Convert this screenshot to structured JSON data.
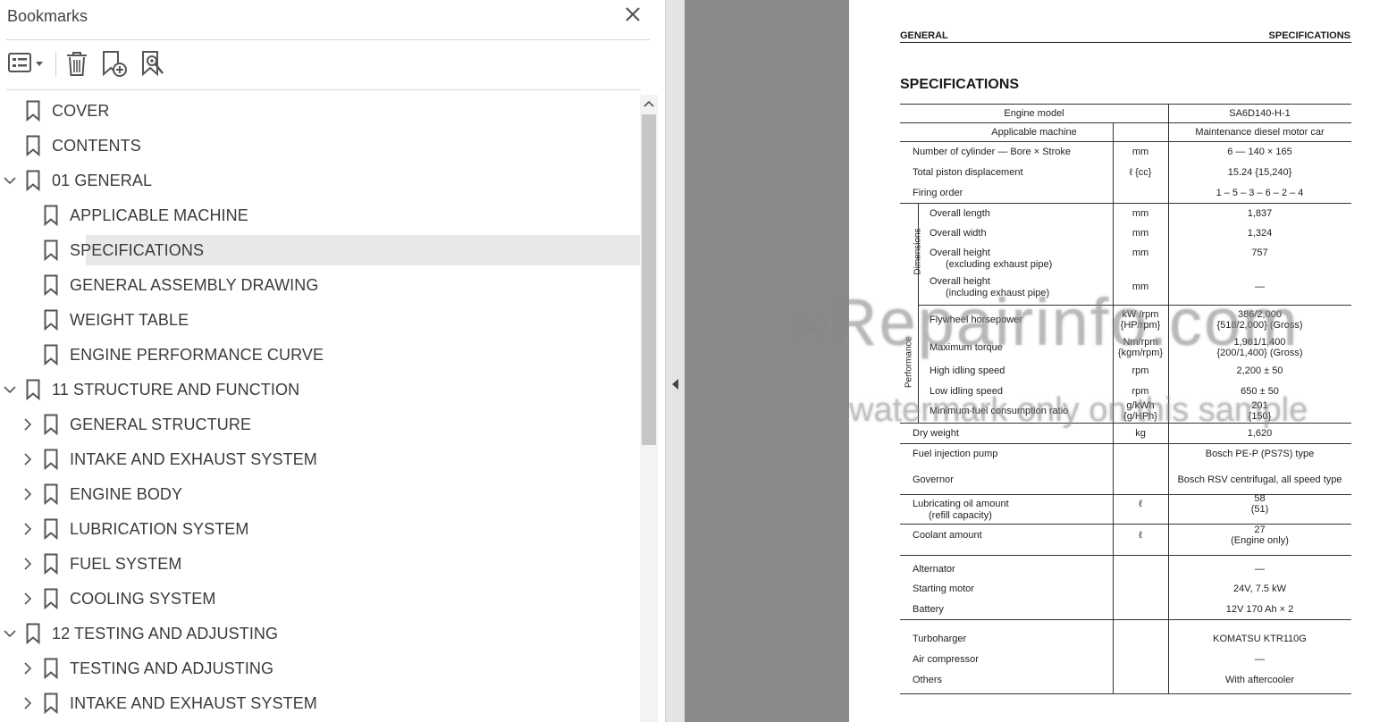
{
  "bookmarks_panel": {
    "title": "Bookmarks",
    "toolbar": {
      "options_icon": "list-options-icon",
      "delete_icon": "trash-icon",
      "add_icon": "bookmark-add-icon",
      "find_icon": "bookmark-search-icon"
    },
    "items": [
      {
        "label": "COVER",
        "level": 0,
        "expander": "none"
      },
      {
        "label": "CONTENTS",
        "level": 0,
        "expander": "none"
      },
      {
        "label": "01 GENERAL",
        "level": 0,
        "expander": "expanded"
      },
      {
        "label": "APPLICABLE MACHINE",
        "level": 1,
        "expander": "none"
      },
      {
        "label": "SPECIFICATIONS",
        "level": 1,
        "expander": "none",
        "selected": true
      },
      {
        "label": "GENERAL ASSEMBLY DRAWING",
        "level": 1,
        "expander": "none"
      },
      {
        "label": "WEIGHT TABLE",
        "level": 1,
        "expander": "none"
      },
      {
        "label": "ENGINE PERFORMANCE CURVE",
        "level": 1,
        "expander": "none"
      },
      {
        "label": "11 STRUCTURE AND FUNCTION",
        "level": 0,
        "expander": "expanded"
      },
      {
        "label": "GENERAL STRUCTURE",
        "level": 1,
        "expander": "collapsed"
      },
      {
        "label": "INTAKE AND EXHAUST SYSTEM",
        "level": 1,
        "expander": "collapsed"
      },
      {
        "label": "ENGINE BODY",
        "level": 1,
        "expander": "collapsed"
      },
      {
        "label": "LUBRICATION SYSTEM",
        "level": 1,
        "expander": "collapsed"
      },
      {
        "label": "FUEL SYSTEM",
        "level": 1,
        "expander": "collapsed"
      },
      {
        "label": "COOLING SYSTEM",
        "level": 1,
        "expander": "collapsed"
      },
      {
        "label": "12 TESTING AND ADJUSTING",
        "level": 0,
        "expander": "expanded"
      },
      {
        "label": "TESTING AND ADJUSTING",
        "level": 1,
        "expander": "collapsed"
      },
      {
        "label": "INTAKE AND EXHAUST SYSTEM",
        "level": 1,
        "expander": "collapsed"
      }
    ]
  },
  "document": {
    "header_left": "GENERAL",
    "header_right": "SPECIFICATIONS",
    "title": "SPECIFICATIONS",
    "groups": {
      "dimensions": "Dimensions",
      "performance": "Performance"
    },
    "rows": [
      {
        "item": "Engine model",
        "unit": "",
        "value": "SA6D140-H-1"
      },
      {
        "item": "Applicable machine",
        "unit": "",
        "value": "Maintenance diesel motor car"
      },
      {
        "item": "Number of cylinder — Bore × Stroke",
        "unit": "mm",
        "value": "6 — 140 × 165"
      },
      {
        "item": "Total piston displacement",
        "unit": "ℓ {cc}",
        "value": "15.24 {15,240}"
      },
      {
        "item": "Firing order",
        "unit": "",
        "value": "1 – 5 – 3 – 6 – 2 – 4"
      },
      {
        "item": "Overall length",
        "unit": "mm",
        "value": "1,837"
      },
      {
        "item": "Overall width",
        "unit": "mm",
        "value": "1,324"
      },
      {
        "item": "Overall height",
        "item2": "(excluding exhaust pipe)",
        "unit": "mm",
        "value": "757"
      },
      {
        "item": "Overall height",
        "item2": "(including exhaust pipe)",
        "unit": "mm",
        "value": "—"
      },
      {
        "item": "Flywheel horsepower",
        "unit": "kW /rpm",
        "unit2": "{HP/rpm}",
        "value": "386/2,000",
        "value2": "{518/2,000} (Gross)"
      },
      {
        "item": "Maximum torque",
        "unit": "Nm/rpm",
        "unit2": "{kgm/rpm}",
        "value": "1,961/1,400",
        "value2": "{200/1,400} (Gross)"
      },
      {
        "item": "High idling speed",
        "unit": "rpm",
        "value": "2,200 ± 50"
      },
      {
        "item": "Low idling speed",
        "unit": "rpm",
        "value": "650 ± 50"
      },
      {
        "item": "Minimum fuel consumption ratio",
        "unit": "g/kWh",
        "unit2": "{g/HPh}",
        "value": "201",
        "value2": "{150}"
      },
      {
        "item": "Dry weight",
        "unit": "kg",
        "value": "1,620"
      },
      {
        "item": "Fuel injection pump",
        "unit": "",
        "value": "Bosch PE-P (PS7S) type"
      },
      {
        "item": "Governor",
        "unit": "",
        "value": "Bosch RSV centrifugal, all speed type"
      },
      {
        "item": "Lubricating oil amount",
        "item2": "(refill capacity)",
        "unit": "ℓ",
        "value": "58",
        "value2": "(51)"
      },
      {
        "item": "Coolant amount",
        "unit": "ℓ",
        "value": "27",
        "value2": "(Engine only)"
      },
      {
        "item": "Alternator",
        "unit": "",
        "value": "—"
      },
      {
        "item": "Starting motor",
        "unit": "",
        "value": "24V, 7.5 kW"
      },
      {
        "item": "Battery",
        "unit": "",
        "value": "12V 170 Ah × 2"
      },
      {
        "item": "Turboharger",
        "unit": "",
        "value": "KOMATSU KTR110G"
      },
      {
        "item": "Air compressor",
        "unit": "",
        "value": "—"
      },
      {
        "item": "Others",
        "unit": "",
        "value": "With aftercooler"
      }
    ],
    "watermark_main": "eRepairinfo.com",
    "watermark_sub": "watermark only on this sample"
  }
}
